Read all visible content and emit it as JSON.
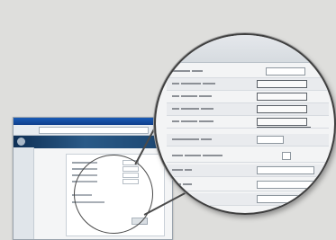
{
  "magnifier": {
    "header_left": "",
    "header_right": "",
    "rows": [
      {
        "label": "",
        "value": ""
      },
      {
        "label": "",
        "value": ""
      },
      {
        "label": "",
        "value": ""
      },
      {
        "label": "",
        "value": ""
      },
      {
        "label": "",
        "value": ""
      },
      {
        "label": "",
        "value": ""
      },
      {
        "label": "",
        "value": ""
      },
      {
        "label": "",
        "value": ""
      },
      {
        "label": "",
        "value": ""
      },
      {
        "label": "",
        "value": ""
      },
      {
        "label": "",
        "value": ""
      }
    ]
  },
  "icons": {
    "browser_logo": "globe-icon"
  },
  "colors": {
    "background": "#dededc",
    "browser_titlebar": "#1a5bb6",
    "browser_banner": "#0e2f55",
    "circle_border": "#3f3f3f"
  }
}
